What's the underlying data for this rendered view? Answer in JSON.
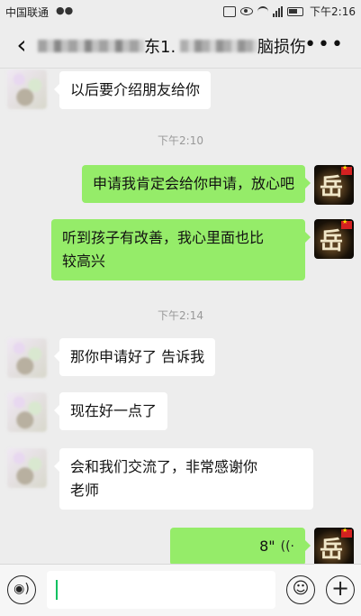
{
  "status_bar": {
    "carrier": "中国联通",
    "time": "下午2:16"
  },
  "nav": {
    "title_visible_a": "东1.",
    "title_visible_b": "脑损伤",
    "back_icon": "chevron-left-icon",
    "more_icon": "more-icon"
  },
  "messages": [
    {
      "side": "left",
      "text": "以后要介绍朋友给你"
    },
    {
      "type": "time",
      "text": "下午2:10"
    },
    {
      "side": "right",
      "text": "申请我肯定会给你申请，放心吧"
    },
    {
      "side": "right",
      "text_line1": "听到孩子有改善，我心里面也比",
      "text_line2": "较高兴"
    },
    {
      "type": "time",
      "text": "下午2:14"
    },
    {
      "side": "left",
      "text": "那你申请好了 告诉我"
    },
    {
      "side": "left",
      "text": "现在好一点了"
    },
    {
      "side": "left",
      "text_line1": "会和我们交流了，非常感谢你",
      "text_line2": "老师"
    },
    {
      "side": "right",
      "kind": "voice",
      "duration": "8\""
    }
  ],
  "right_avatar": {
    "glyph": "岳"
  },
  "input_bar": {
    "voice_icon": "voice-mode-icon",
    "emoji_icon": "emoji-icon",
    "plus_icon": "plus-icon"
  },
  "colors": {
    "background": "#ededed",
    "bubble_self": "#95ec69",
    "bubble_other": "#ffffff",
    "cursor": "#07c160"
  }
}
